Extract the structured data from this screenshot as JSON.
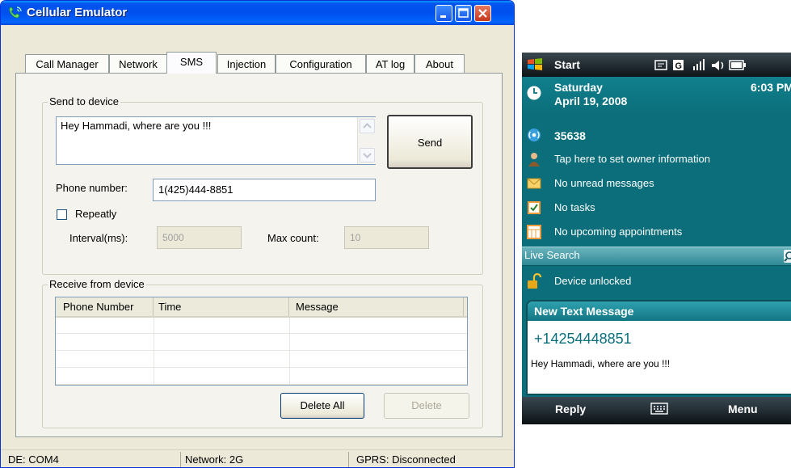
{
  "window": {
    "title": "Cellular Emulator"
  },
  "tabs": [
    {
      "label": "Call Manager"
    },
    {
      "label": "Network"
    },
    {
      "label": "SMS"
    },
    {
      "label": "Injection"
    },
    {
      "label": "Configuration"
    },
    {
      "label": "AT log"
    },
    {
      "label": "About"
    }
  ],
  "send": {
    "group_label": "Send to device",
    "message": "Hey Hammadi, where are you !!!",
    "send_label": "Send",
    "phone_label": "Phone number:",
    "phone_value": "1(425)444-8851",
    "repeatly_label": "Repeatly",
    "repeatly_checked": false,
    "interval_label": "Interval(ms):",
    "interval_value": "5000",
    "max_label": "Max count:",
    "max_value": "10"
  },
  "receive": {
    "group_label": "Receive from device",
    "columns": [
      "Phone Number",
      "Time",
      "Message"
    ],
    "delete_all_label": "Delete All",
    "delete_label": "Delete"
  },
  "status": {
    "de": "DE: COM4",
    "network": "Network: 2G",
    "gprs": "GPRS: Disconnected"
  },
  "device": {
    "start_label": "Start",
    "day": "Saturday",
    "date": "April 19, 2008",
    "time": "6:03 PM",
    "carrier_number": "35638",
    "owner_info": "Tap here to set owner information",
    "messages": "No unread messages",
    "tasks": "No tasks",
    "appointments": "No upcoming appointments",
    "search_label": "Live Search",
    "device_lock": "Device unlocked",
    "notification_title": "New Text Message",
    "notification_sender": "+14254448851",
    "notification_body": "Hey Hammadi, where are you !!!",
    "reply_label": "Reply",
    "menu_label": "Menu"
  },
  "colors": {
    "xp_title": "#0054e3",
    "ppc_teal": "#0b6e7a",
    "notif_header": "#1d8b9a"
  }
}
